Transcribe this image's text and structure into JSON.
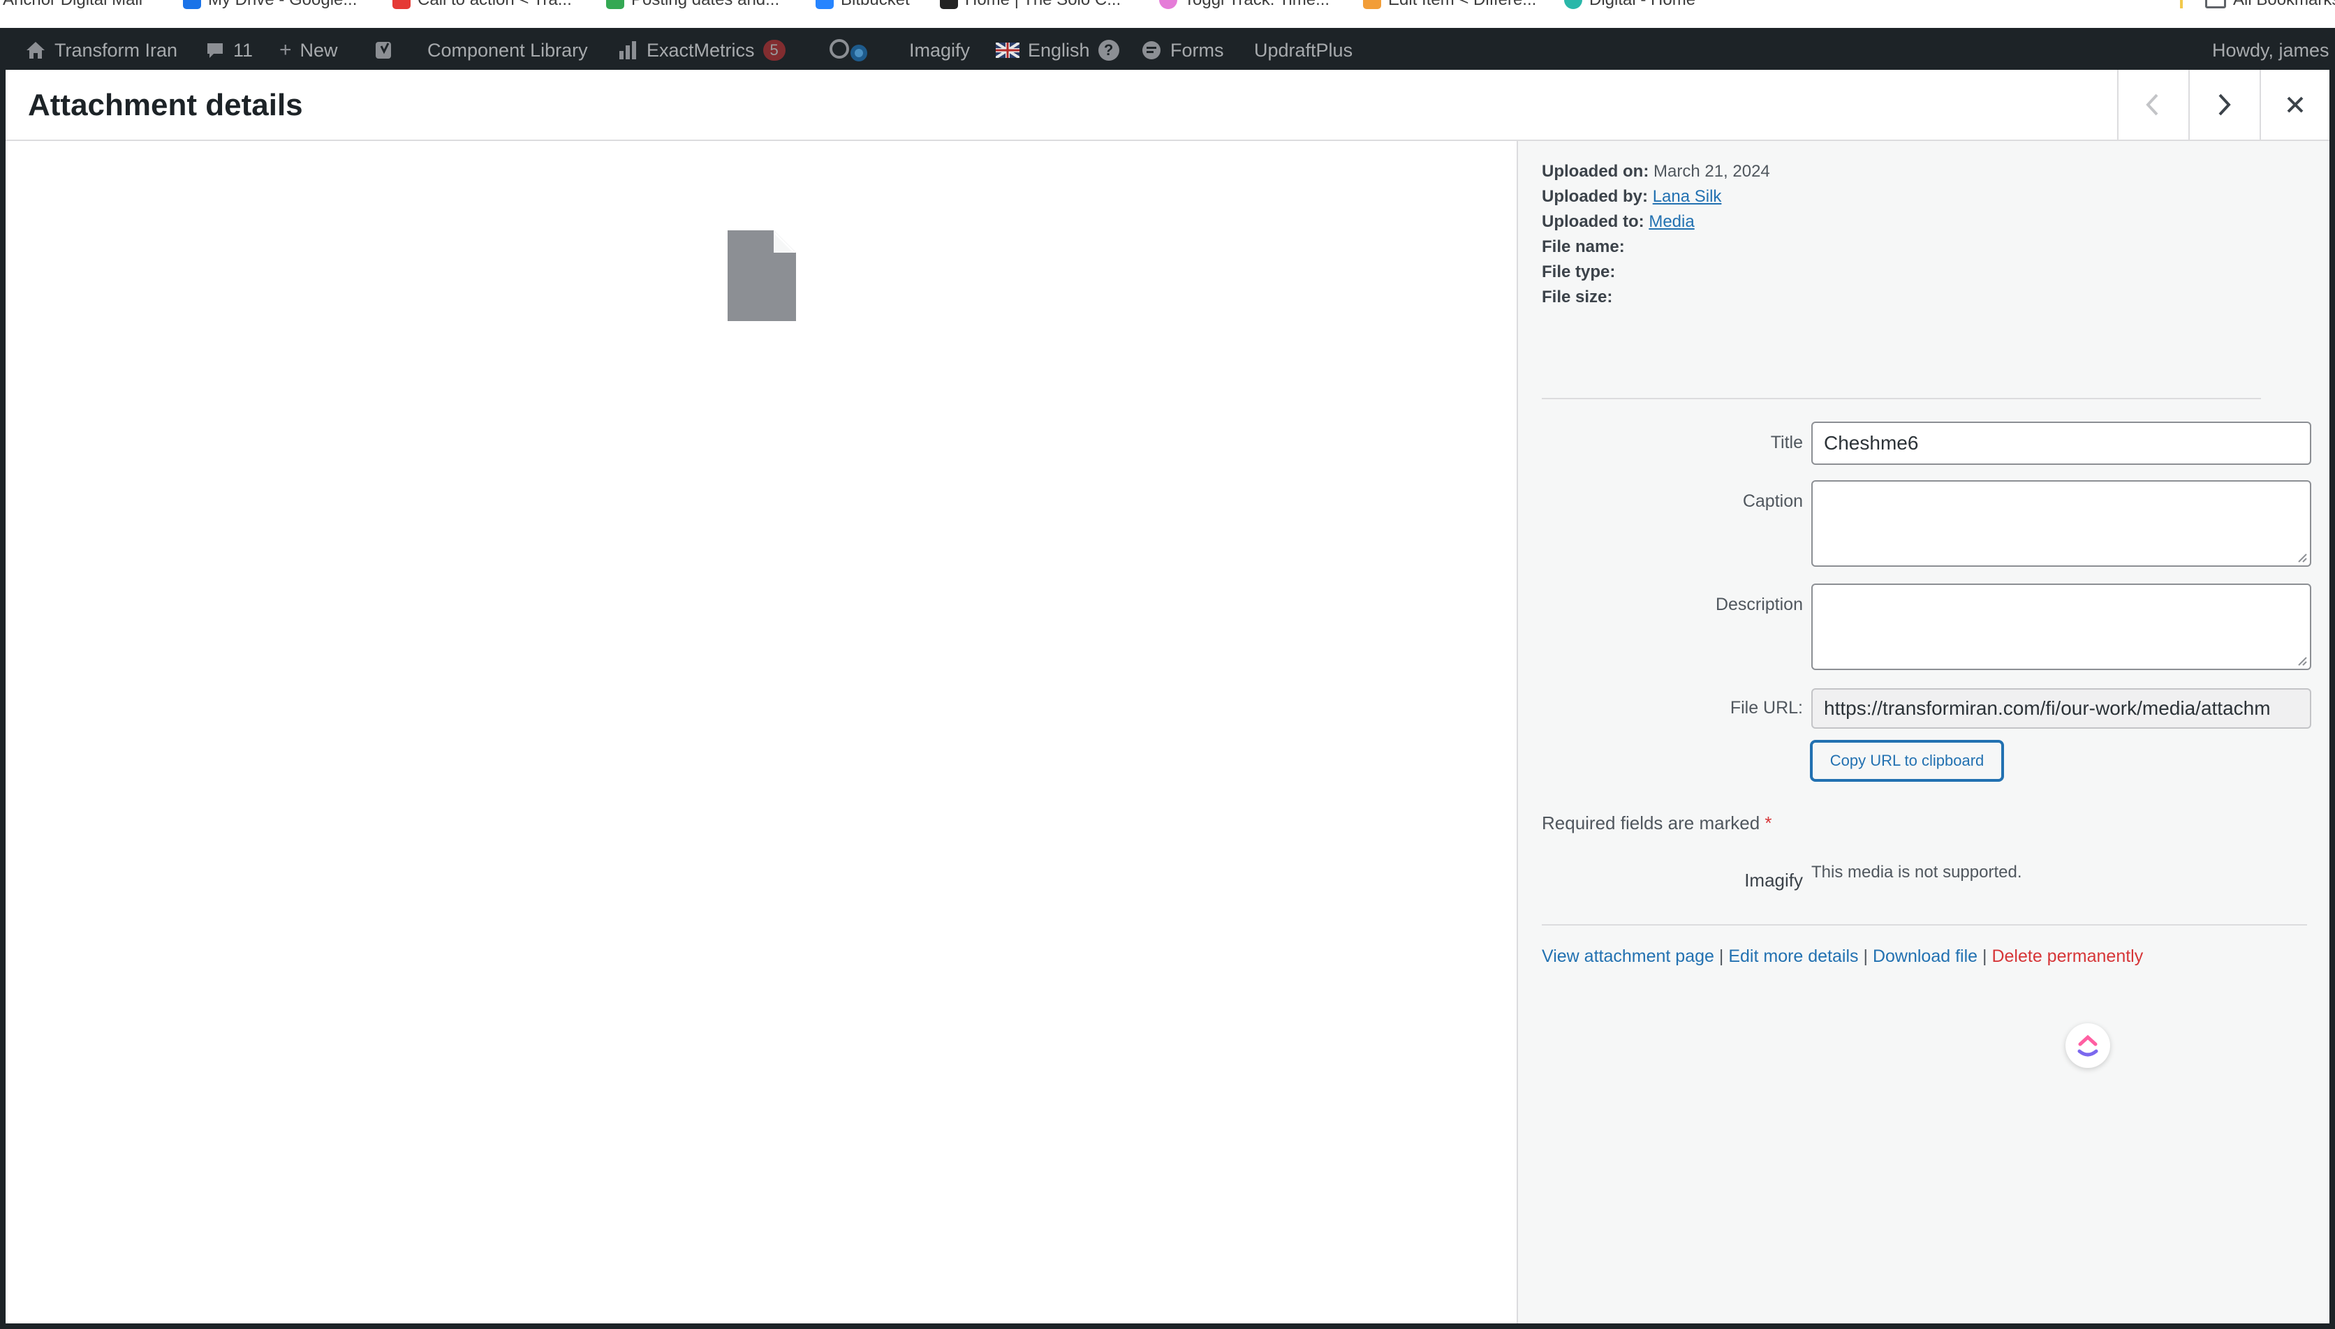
{
  "bookmarks": [
    {
      "label": "Anchor Digital Mail",
      "color": "#c5221f"
    },
    {
      "label": "My Drive - Google...",
      "color": "#1a73e8"
    },
    {
      "label": "Call to action < Tra...",
      "color": "#e53935"
    },
    {
      "label": "Posting dates and...",
      "color": "#34a853"
    },
    {
      "label": "Bitbucket",
      "color": "#2684ff"
    },
    {
      "label": "Home | The Solo C...",
      "color": "#222222"
    },
    {
      "label": "Toggl Track: Time...",
      "color": "#e57cd8"
    },
    {
      "label": "Edit Item < Differe...",
      "color": "#f29d38"
    },
    {
      "label": "Digital - Home",
      "color": "#2ab7a9"
    },
    {
      "label": "All Bookmarks",
      "color": "#5f6368"
    }
  ],
  "adminbar": {
    "site_name": "Transform Iran",
    "comments_count": "11",
    "new_label": "New",
    "component_library": "Component Library",
    "exactmetrics": "ExactMetrics",
    "exactmetrics_count": "5",
    "imagify": "Imagify",
    "language": "English",
    "forms": "Forms",
    "updraftplus": "UpdraftPlus",
    "howdy": "Howdy, james"
  },
  "modal": {
    "title": "Attachment details"
  },
  "meta": {
    "uploaded_on_label": "Uploaded on:",
    "uploaded_on": "March 21, 2024",
    "uploaded_by_label": "Uploaded by:",
    "uploaded_by": "Lana Silk",
    "uploaded_to_label": "Uploaded to:",
    "uploaded_to": "Media",
    "file_name_label": "File name:",
    "file_type_label": "File type:",
    "file_size_label": "File size:"
  },
  "fields": {
    "title_label": "Title",
    "title_value": "Cheshme6",
    "caption_label": "Caption",
    "description_label": "Description",
    "file_url_label": "File URL:",
    "file_url_value": "https://transformiran.com/fi/our-work/media/attachm",
    "copy_button": "Copy URL to clipboard"
  },
  "required_note": "Required fields are marked",
  "required_star": "*",
  "imagify": {
    "label": "Imagify",
    "message": "This media is not supported."
  },
  "actions": {
    "view": "View attachment page",
    "edit": "Edit more details",
    "download": "Download file",
    "delete": "Delete permanently",
    "separator": "|"
  },
  "colors": {
    "admin_bar_bg": "#1d2327",
    "link": "#2271b1",
    "danger": "#d63638"
  }
}
